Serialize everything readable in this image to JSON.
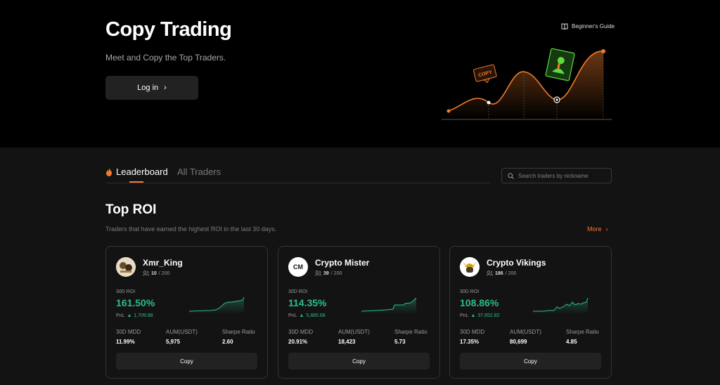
{
  "hero": {
    "title": "Copy Trading",
    "subtitle": "Meet and Copy the Top Traders.",
    "login_label": "Log in",
    "guide_label": "Beginner's Guide",
    "illustration_tag": "COPY"
  },
  "tabs": {
    "leaderboard": "Leaderboard",
    "all_traders": "All Traders"
  },
  "search": {
    "placeholder": "Search traders by nickname"
  },
  "section": {
    "title": "Top ROI",
    "subtitle": "Traders that have earned the highest ROI in the last 30 days.",
    "more_label": "More"
  },
  "labels": {
    "roi": "30D ROI",
    "pnl": "PnL",
    "mdd": "30D MDD",
    "aum": "AUM(USDT)",
    "sharpe": "Sharpe Ratio",
    "copy": "Copy"
  },
  "traders": [
    {
      "name": "Xmr_King",
      "followers": "10",
      "capacity": "/ 200",
      "roi": "161.50%",
      "pnl": "1,709.88",
      "mdd": "11.99%",
      "aum": "5,975",
      "sharpe": "2.60"
    },
    {
      "name": "Crypto Mister",
      "followers": "39",
      "capacity": "/ 200",
      "roi": "114.35%",
      "pnl": "5,885.68",
      "mdd": "20.91%",
      "aum": "18,423",
      "sharpe": "5.73",
      "avatar_text": "CM"
    },
    {
      "name": "Crypto Vikings",
      "followers": "186",
      "capacity": "/ 200",
      "roi": "108.86%",
      "pnl": "37,652.82",
      "mdd": "17.35%",
      "aum": "80,699",
      "sharpe": "4.85"
    }
  ],
  "colors": {
    "accent": "#f07b2b",
    "positive": "#2ebd85",
    "bg": "#131313"
  }
}
